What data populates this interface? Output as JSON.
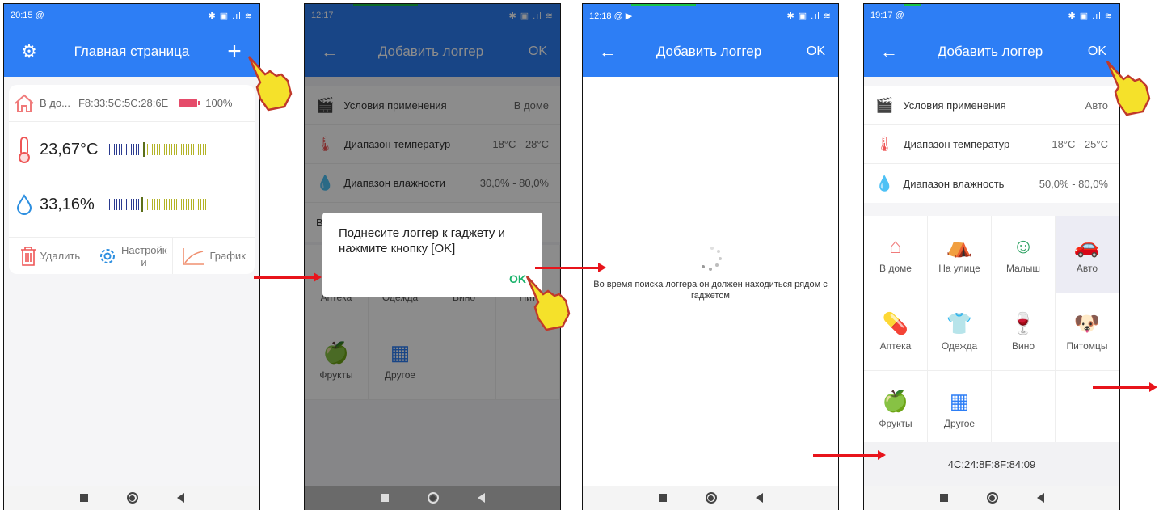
{
  "colors": {
    "appbar": "#2d7ef5",
    "accent_ok": "#18b26a",
    "arrow": "#e8141b"
  },
  "screen1": {
    "status_time": "20:15 @",
    "status_icons": "✱ ▣ .ıl ≋",
    "title": "Главная страница",
    "settings_icon": "⚙",
    "add_icon": "+",
    "device_name": "В до...",
    "device_mac": "F8:33:5C:5C:28:6E",
    "battery_percent": "100%",
    "battery_level": 1.0,
    "temperature": "23,67°C",
    "humidity": "33,16%",
    "delete_label": "Удалить",
    "settings_label": "Настройк и",
    "graph_label": "График"
  },
  "screen2": {
    "status_time": "12:17",
    "status_icons": "✱ ▣ .ıl ≋",
    "back_icon": "←",
    "title": "Добавить логгер",
    "ok_label": "OK",
    "rows": [
      {
        "label": "Условия применения",
        "value": "В доме"
      },
      {
        "label": "Диапазон температур",
        "value": "18°C - 28°C"
      },
      {
        "label": "Диапазон влажности",
        "value": "30,0% - 80,0%"
      }
    ],
    "partial_row": "В",
    "grid": [
      {
        "label": "Аптека"
      },
      {
        "label": "Одежда"
      },
      {
        "label": "Вино"
      },
      {
        "label": "Пит"
      },
      {
        "label": "Фрукты"
      },
      {
        "label": "Другое"
      }
    ],
    "dialog_message": "Поднесите логгер к гаджету и нажмите кнопку [OK]",
    "dialog_ok": "OK"
  },
  "screen3": {
    "status_time": "12:18 @ ▶",
    "status_icons": "✱ ▣ .ıl ≋",
    "back_icon": "←",
    "title": "Добавить логгер",
    "ok_label": "OK",
    "search_message": "Во время поиска логгера он должен находиться рядом с гаджетом"
  },
  "screen4": {
    "status_time": "19:17 @",
    "status_icons": "✱ ▣ .ıl ≋",
    "back_icon": "←",
    "title": "Добавить логгер",
    "ok_label": "OK",
    "rows": [
      {
        "label": "Условия применения",
        "value": "Авто"
      },
      {
        "label": "Диапазон температур",
        "value": "18°C - 25°C"
      },
      {
        "label": "Диапазон влажность",
        "value": "50,0% - 80,0%"
      }
    ],
    "grid": [
      {
        "label": "В доме"
      },
      {
        "label": "На улице"
      },
      {
        "label": "Малыш"
      },
      {
        "label": "Авто"
      },
      {
        "label": "Аптека"
      },
      {
        "label": "Одежда"
      },
      {
        "label": "Вино"
      },
      {
        "label": "Питомцы"
      },
      {
        "label": "Фрукты"
      },
      {
        "label": "Другое"
      }
    ],
    "selected": "Авто",
    "mac": "4C:24:8F:8F:84:09"
  }
}
